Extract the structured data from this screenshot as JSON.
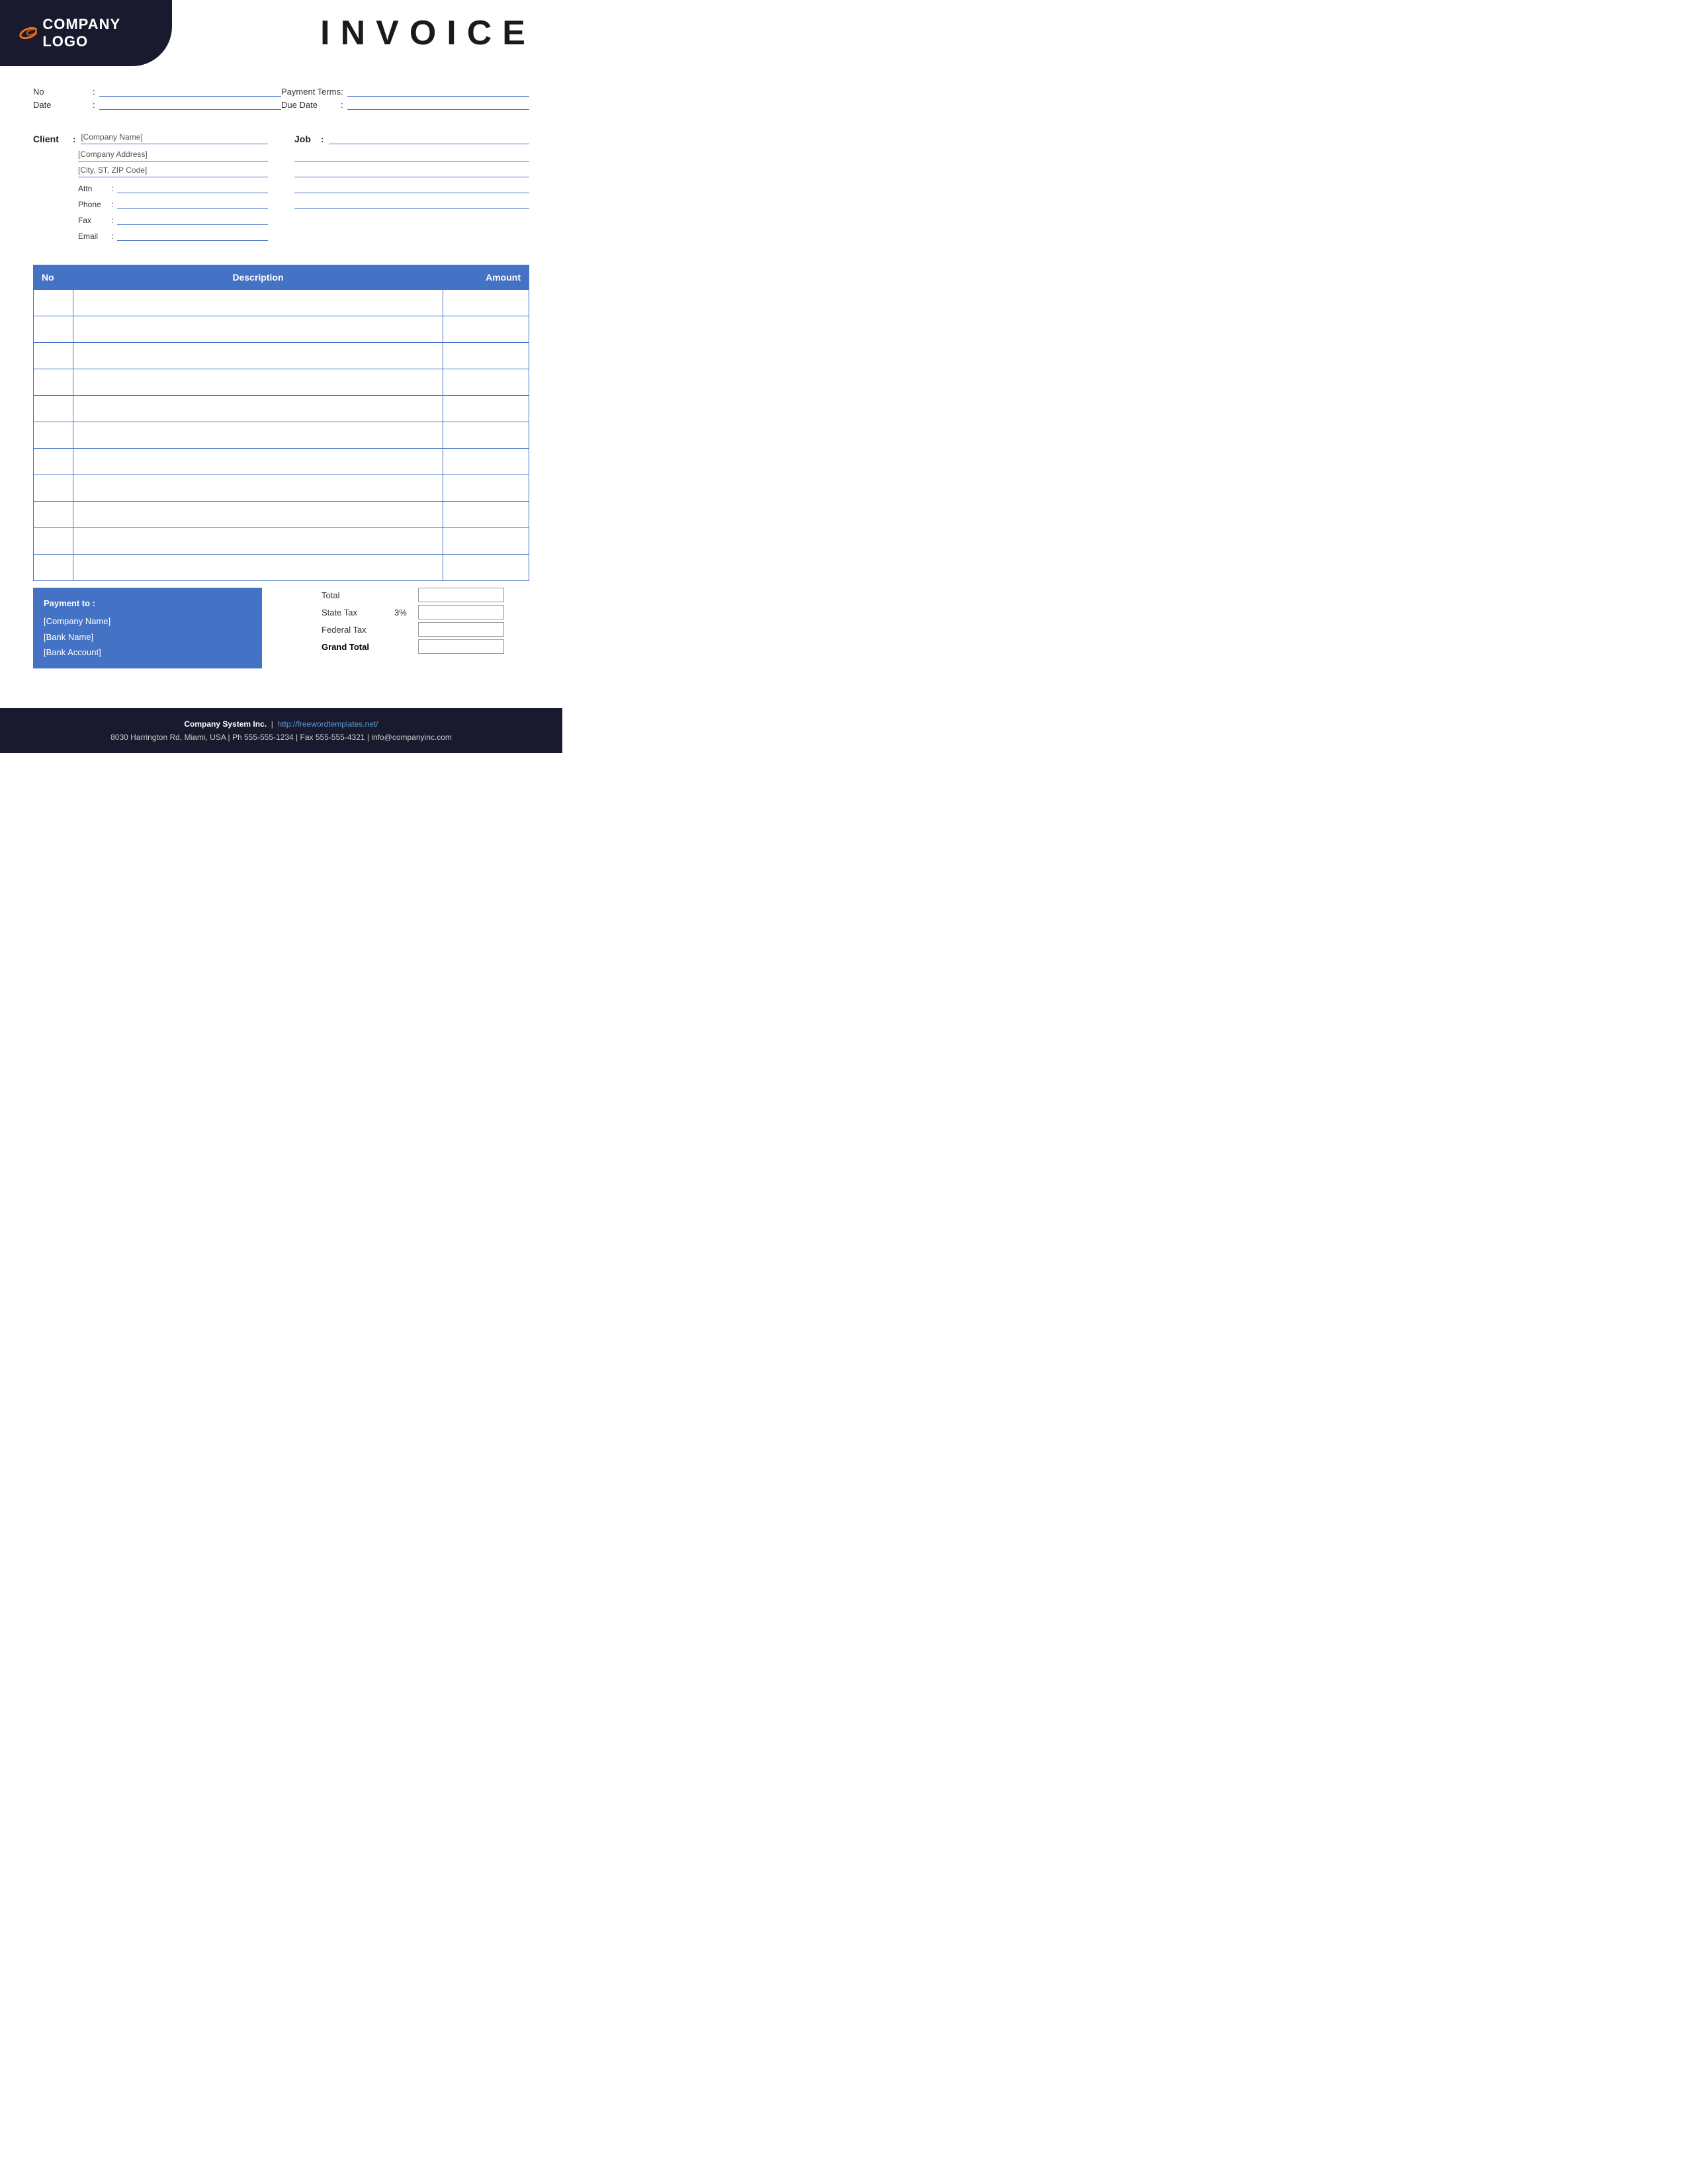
{
  "header": {
    "logo_text": "COMPANY LOGO",
    "invoice_title": "INVOICE"
  },
  "meta": {
    "no_label": "No",
    "date_label": "Date",
    "payment_terms_label": "Payment  Terms",
    "due_date_label": "Due Date"
  },
  "client": {
    "label": "Client",
    "company_name": "[Company Name]",
    "company_address": "[Company Address]",
    "city": "[City, ST, ZIP Code]",
    "attn_label": "Attn",
    "phone_label": "Phone",
    "fax_label": "Fax",
    "email_label": "Email"
  },
  "job": {
    "label": "Job"
  },
  "table": {
    "col_no": "No",
    "col_description": "Description",
    "col_amount": "Amount",
    "rows": [
      {
        "no": "",
        "description": "",
        "amount": ""
      },
      {
        "no": "",
        "description": "",
        "amount": ""
      },
      {
        "no": "",
        "description": "",
        "amount": ""
      },
      {
        "no": "",
        "description": "",
        "amount": ""
      },
      {
        "no": "",
        "description": "",
        "amount": ""
      },
      {
        "no": "",
        "description": "",
        "amount": ""
      },
      {
        "no": "",
        "description": "",
        "amount": ""
      },
      {
        "no": "",
        "description": "",
        "amount": ""
      },
      {
        "no": "",
        "description": "",
        "amount": ""
      },
      {
        "no": "",
        "description": "",
        "amount": ""
      },
      {
        "no": "",
        "description": "",
        "amount": ""
      }
    ]
  },
  "payment": {
    "label": "Payment to :",
    "company_name": "[Company Name]",
    "bank_name": "[Bank Name]",
    "bank_account": "[Bank Account]"
  },
  "totals": {
    "total_label": "Total",
    "state_tax_label": "State Tax",
    "state_tax_pct": "3%",
    "federal_tax_label": "Federal Tax",
    "grand_total_label": "Grand Total"
  },
  "footer": {
    "company": "Company System Inc.",
    "separator": "|",
    "website": "http://freewordtemplates.net/",
    "address": "8030 Harrington Rd, Miami, USA | Ph 555-555-1234 | Fax 555-555-4321 | info@companyinc.com"
  }
}
